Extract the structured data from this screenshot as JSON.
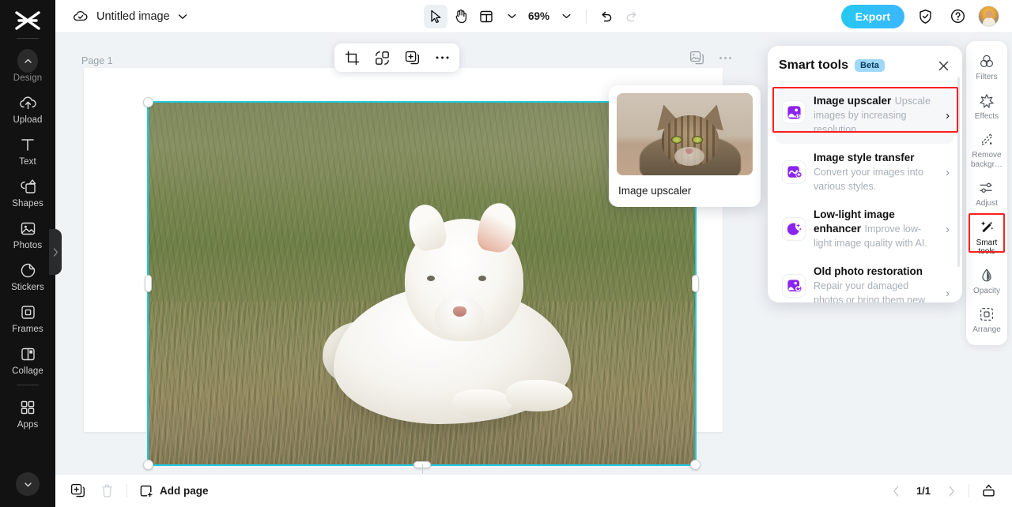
{
  "app": {
    "accent_cyan": "#1fc8e0",
    "accent_purple": "#8b23f0",
    "highlight_red": "#ff1f1f",
    "export_gradient": "#25c8f0"
  },
  "left_rail": {
    "logo_name": "capcut-logo",
    "items": [
      {
        "label": "Design",
        "icon": "chevron-up-circle-icon"
      },
      {
        "label": "Upload",
        "icon": "cloud-upload-icon"
      },
      {
        "label": "Text",
        "icon": "text-icon"
      },
      {
        "label": "Shapes",
        "icon": "shapes-icon"
      },
      {
        "label": "Photos",
        "icon": "photo-icon"
      },
      {
        "label": "Stickers",
        "icon": "sticker-icon"
      },
      {
        "label": "Frames",
        "icon": "frame-icon"
      },
      {
        "label": "Collage",
        "icon": "collage-icon"
      },
      {
        "label": "Apps",
        "icon": "apps-grid-icon"
      }
    ],
    "collapse_icon": "chevron-down-circle-icon"
  },
  "topbar": {
    "cloud_icon": "cloud-saved-icon",
    "doc_title": "Untitled image",
    "title_caret": "chevron-down-icon",
    "tools": [
      {
        "name": "select-tool",
        "icon": "cursor-arrow-icon",
        "active": true
      },
      {
        "name": "hand-tool",
        "icon": "hand-icon",
        "active": false
      },
      {
        "name": "layout-tool",
        "icon": "layout-icon",
        "active": false
      }
    ],
    "zoom_value": "69%",
    "undo_icon": "undo-arrow-icon",
    "redo_icon": "redo-arrow-icon",
    "export_label": "Export",
    "shield_icon": "shield-check-icon",
    "help_icon": "question-circle-icon",
    "avatar_name": "user-avatar"
  },
  "canvas": {
    "page_label": "Page 1",
    "element_toolbar": [
      {
        "name": "crop-button",
        "icon": "crop-icon"
      },
      {
        "name": "replace-button",
        "icon": "replace-image-icon"
      },
      {
        "name": "duplicate-button",
        "icon": "duplicate-icon"
      },
      {
        "name": "more-button",
        "icon": "more-horizontal-icon"
      }
    ],
    "page_tools": [
      {
        "name": "page-duplicate-button",
        "icon": "duplicate-page-icon"
      },
      {
        "name": "page-more-button",
        "icon": "more-horizontal-icon"
      }
    ],
    "rotate_icon": "rotate-icon",
    "selected_image_alt": "white samoyed puppy lying on grass"
  },
  "preview_card": {
    "label": "Image upscaler",
    "image_alt": "tabby cat close-up"
  },
  "smart_panel": {
    "title": "Smart tools",
    "badge": "Beta",
    "close_icon": "close-icon",
    "items": [
      {
        "name": "Image upscaler",
        "desc": "Upscale images by increasing resolution.",
        "icon": "upscaler-4k-icon",
        "selected": true,
        "arrow": "›"
      },
      {
        "name": "Image style transfer",
        "desc": "Convert your images into various styles.",
        "icon": "style-transfer-icon",
        "selected": false,
        "arrow": "›"
      },
      {
        "name": "Low-light image enhancer",
        "desc": "Improve low-light image quality with AI.",
        "icon": "moon-stars-icon",
        "selected": false,
        "arrow": "›"
      },
      {
        "name": "Old photo restoration",
        "desc": "Repair your damaged photos or bring them new life with…",
        "icon": "photo-restore-icon",
        "selected": false,
        "arrow": "›"
      }
    ]
  },
  "right_rail": {
    "items": [
      {
        "label": "Filters",
        "icon": "filters-icon",
        "selected": false
      },
      {
        "label": "Effects",
        "icon": "effects-icon",
        "selected": false
      },
      {
        "label": "Remove backgr…",
        "icon": "remove-bg-icon",
        "selected": false
      },
      {
        "label": "Adjust",
        "icon": "adjust-sliders-icon",
        "selected": false
      },
      {
        "label": "Smart tools",
        "icon": "magic-wand-icon",
        "selected": true
      },
      {
        "label": "Opacity",
        "icon": "opacity-drop-icon",
        "selected": false
      },
      {
        "label": "Arrange",
        "icon": "arrange-icon",
        "selected": false
      }
    ]
  },
  "bottombar": {
    "duplicate_icon": "duplicate-page-icon",
    "delete_icon": "trash-icon",
    "add_page_label": "Add page",
    "add_page_icon": "add-page-icon",
    "prev_icon": "chevron-left-icon",
    "next_icon": "chevron-right-icon",
    "page_indicator": "1/1",
    "panel_toggle_icon": "expand-panel-icon"
  }
}
